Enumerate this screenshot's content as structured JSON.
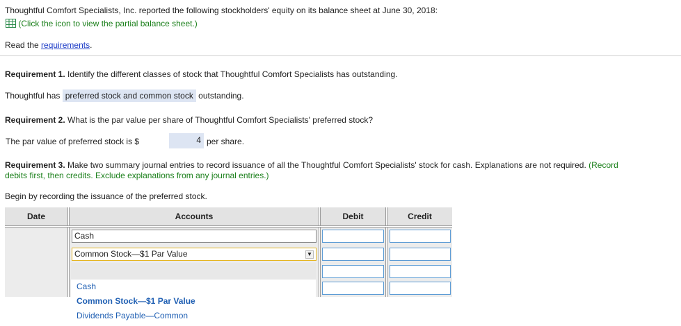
{
  "intro": {
    "statement": "Thoughtful Comfort Specialists, Inc. reported the following stockholders' equity on its balance sheet at June 30, 2018:",
    "icon": "spreadsheet-icon",
    "icon_link": "(Click the icon to view the partial balance sheet.)",
    "read_prefix": "Read the ",
    "requirements_link": "requirements",
    "read_suffix": "."
  },
  "req1": {
    "label": "Requirement 1.",
    "question": " Identify the different classes of stock that Thoughtful Comfort Specialists has outstanding.",
    "answer_prefix": "Thoughtful has",
    "answer_value": "preferred stock and common stock",
    "answer_suffix": "outstanding."
  },
  "req2": {
    "label": "Requirement 2.",
    "question": " What is the par value per share of Thoughtful Comfort Specialists' preferred stock?",
    "answer_prefix": "The par value of preferred stock is $",
    "answer_value": "4",
    "answer_suffix": "per share."
  },
  "req3": {
    "label": "Requirement 3.",
    "question": " Make two summary journal entries to record issuance of all the Thoughtful Comfort Specialists' stock for cash. Explanations are not required.",
    "instruction_line1": "(Record",
    "instruction_line2": "debits first, then credits. Exclude explanations from any journal entries.)",
    "begin": "Begin by recording the issuance of the preferred stock."
  },
  "journal": {
    "headers": {
      "date": "Date",
      "accounts": "Accounts",
      "debit": "Debit",
      "credit": "Credit"
    },
    "rows": [
      {
        "account": "Cash",
        "debit": "",
        "credit": ""
      },
      {
        "account": "Common Stock—$1 Par Value",
        "debit": "",
        "credit": ""
      },
      {
        "account": "",
        "debit": "",
        "credit": ""
      },
      {
        "account": "",
        "debit": "",
        "credit": ""
      }
    ],
    "dropdown_options": [
      "Cash",
      "Common Stock—$1 Par Value",
      "Dividends Payable—Common"
    ],
    "dropdown_selected": "Common Stock—$1 Par Value",
    "dropdown_arrow": "▼"
  }
}
